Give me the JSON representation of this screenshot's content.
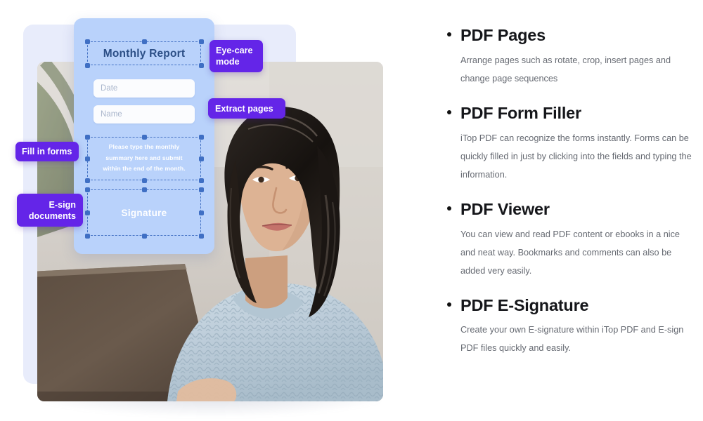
{
  "visual": {
    "form_card": {
      "title": "Monthly Report",
      "fields": [
        {
          "name": "date",
          "placeholder": "Date"
        },
        {
          "name": "name",
          "placeholder": "Name"
        }
      ],
      "paragraph_lines": [
        "Please type the monthly",
        "summary here and submit",
        "within the end of the month."
      ],
      "signature_label": "Signature"
    },
    "badges": [
      {
        "id": "eye-care-mode",
        "lines": [
          "Eye-care",
          "mode"
        ]
      },
      {
        "id": "extract-pages",
        "lines": [
          "Extract pages"
        ]
      },
      {
        "id": "fill-in-forms",
        "lines": [
          "Fill in forms"
        ]
      },
      {
        "id": "e-sign-documents",
        "lines": [
          "E-sign",
          "documents"
        ]
      }
    ],
    "photo_alt": "woman-using-laptop-photo"
  },
  "features": [
    {
      "title": "PDF Pages",
      "body": "Arrange pages such as rotate, crop, insert pages and change page sequences"
    },
    {
      "title": "PDF Form Filler",
      "body": "iTop PDF can recognize the forms instantly. Forms can be quickly filled in just by clicking into the fields and typing the information."
    },
    {
      "title": "PDF Viewer",
      "body": "You can view and read PDF content or ebooks in a nice and neat way. Bookmarks and comments can also be added very easily."
    },
    {
      "title": "PDF E-Signature",
      "body": "Create your own E-signature within iTop PDF and E-sign PDF files quickly and easily."
    }
  ],
  "colors": {
    "badge_purple": "#6425e8",
    "card_blue": "#b9d2fb",
    "bg_lavender": "#e8ecfb",
    "title_navy": "#2c4f86",
    "body_gray": "#666a72",
    "heading_black": "#15161a"
  }
}
